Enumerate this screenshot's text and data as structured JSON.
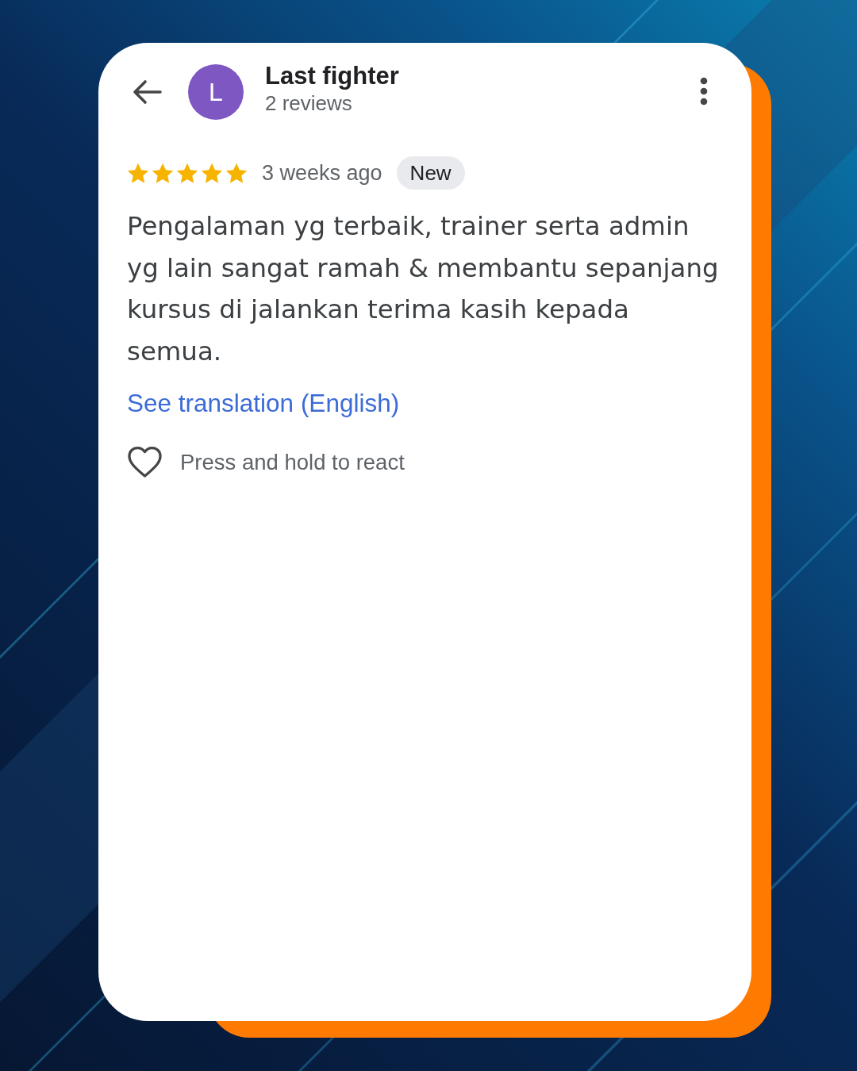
{
  "reviewer": {
    "avatar_letter": "L",
    "name": "Last fighter",
    "review_count": "2 reviews"
  },
  "review": {
    "stars": 5,
    "time": "3 weeks ago",
    "badge": "New",
    "text": "Pengalaman yg terbaik, trainer serta admin yg lain sangat ramah & membantu sepanjang kursus di jalankan terima kasih kepada semua.",
    "translation_link": "See translation (English)"
  },
  "reaction": {
    "hint": "Press and hold to react"
  }
}
